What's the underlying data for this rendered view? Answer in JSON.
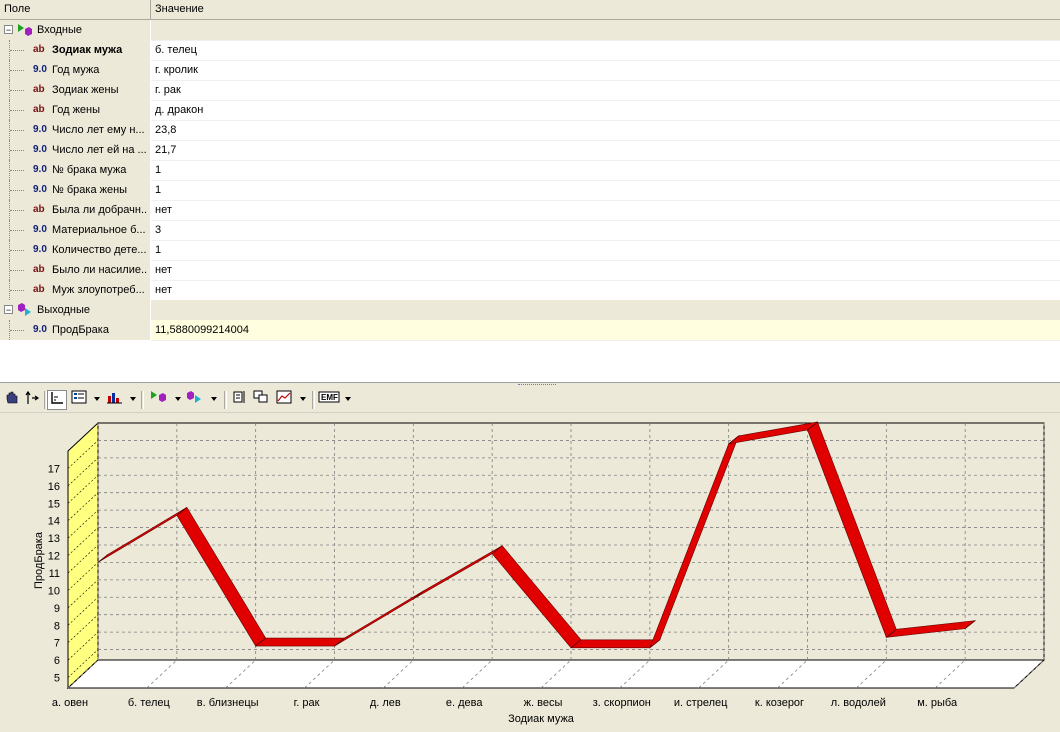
{
  "grid": {
    "col_field": "Поле",
    "col_value": "Значение",
    "inputs_label": "Входные",
    "outputs_label": "Выходные",
    "inputs": [
      {
        "type": "ab",
        "name": "Зодиак мужа",
        "value": "б. телец",
        "bold": true
      },
      {
        "type": "9.0",
        "name": "Год мужа",
        "value": "г. кролик"
      },
      {
        "type": "ab",
        "name": "Зодиак жены",
        "value": "г. рак"
      },
      {
        "type": "ab",
        "name": "Год жены",
        "value": "д. дракон"
      },
      {
        "type": "9.0",
        "name": "Число лет ему н...",
        "value": "23,8"
      },
      {
        "type": "9.0",
        "name": "Число лет ей на ...",
        "value": "21,7"
      },
      {
        "type": "9.0",
        "name": "№ брака мужа",
        "value": "1"
      },
      {
        "type": "9.0",
        "name": "№ брака жены",
        "value": "1"
      },
      {
        "type": "ab",
        "name": "Была ли добрачн...",
        "value": "нет"
      },
      {
        "type": "9.0",
        "name": "Материальное б...",
        "value": "3"
      },
      {
        "type": "9.0",
        "name": "Количество дете...",
        "value": "1"
      },
      {
        "type": "ab",
        "name": "Было ли насилие...",
        "value": "нет"
      },
      {
        "type": "ab",
        "name": "Муж злоупотреб...",
        "value": "нет"
      }
    ],
    "outputs": [
      {
        "type": "9.0",
        "name": "ПродБрака",
        "value": "11,5880099214004"
      }
    ]
  },
  "toolbar": {
    "emf_label": "EMF"
  },
  "colors": {
    "line": "#e00000",
    "wall": "#ffff80",
    "floor": "#ffffff",
    "grid": "#808080",
    "background": "#ece9d8"
  },
  "chart_data": {
    "type": "line",
    "categories": [
      "а. овен",
      "б. телец",
      "в. близнецы",
      "г. рак",
      "д. лев",
      "е. дева",
      "ж. весы",
      "з. скорпион",
      "и. стрелец",
      "к. козерог",
      "л. водолей",
      "м. рыба"
    ],
    "values": [
      10.0,
      12.7,
      5.2,
      5.2,
      7.9,
      10.5,
      5.1,
      5.1,
      16.8,
      17.6,
      5.7,
      6.2
    ],
    "title": "",
    "xlabel": "Зодиак мужа",
    "ylabel": "ПродБрака",
    "yticks": [
      5,
      6,
      7,
      8,
      9,
      10,
      11,
      12,
      13,
      14,
      15,
      16,
      17
    ],
    "ylim": [
      4.4,
      18
    ],
    "grid": true,
    "three_d": true,
    "legend": "none"
  }
}
